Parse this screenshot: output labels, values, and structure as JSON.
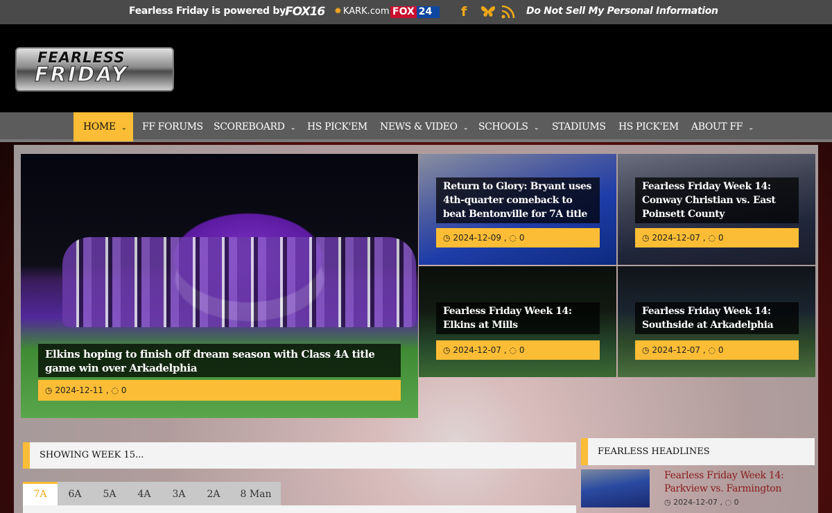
{
  "topbar": {
    "powered_by": "Fearless Friday is powered by:",
    "partners": [
      "FOX16",
      "KARK.com",
      "FOX24"
    ],
    "kark_nbc_glyph": "✹",
    "kark_text": "KARK.com",
    "fox16_text": "FOX16",
    "fox24_a": "FOX",
    "fox24_b": "24",
    "social": {
      "facebook": "f",
      "butterfly": "Ƹ̵̡Ӝ̵̨̄Ʒ",
      "rss": ")))"
    },
    "do_not_sell": "Do Not Sell My Personal Information"
  },
  "header": {
    "logo_line1": "FEARLESS",
    "logo_line2": "FRIDAY"
  },
  "nav": {
    "items": [
      {
        "label": "HOME",
        "dropdown": true,
        "active": true
      },
      {
        "label": "FF FORUMS",
        "dropdown": false
      },
      {
        "label": "SCOREBOARD",
        "dropdown": true
      },
      {
        "label": "HS PICK'EM",
        "dropdown": false
      },
      {
        "label": "NEWS & VIDEO",
        "dropdown": true
      },
      {
        "label": "SCHOOLS",
        "dropdown": true
      },
      {
        "label": "STADIUMS",
        "dropdown": false
      },
      {
        "label": "HS PICK'EM",
        "dropdown": false
      },
      {
        "label": "ABOUT FF",
        "dropdown": true
      }
    ],
    "chevron": "⌄"
  },
  "featured": {
    "main": {
      "title": "Elkins hoping to finish off dream season with Class 4A title game win over Arkadelphia",
      "date": "2024-12-11",
      "comments": "0"
    },
    "tiles": [
      {
        "title": "Return to Glory: Bryant uses 4th-quarter comeback to beat Bentonville for 7A title",
        "date": "2024-12-09",
        "comments": "0"
      },
      {
        "title": "Fearless Friday Week 14: Conway Christian vs. East Poinsett County",
        "date": "2024-12-07",
        "comments": "0"
      },
      {
        "title": "Fearless Friday Week 14: Elkins at Mills",
        "date": "2024-12-07",
        "comments": "0"
      },
      {
        "title": "Fearless Friday Week 14: Southside at Arkadelphia",
        "date": "2024-12-07",
        "comments": "0"
      }
    ],
    "clock_icon": "◷",
    "comment_icon": "◌",
    "meta_sep": ","
  },
  "week_panel": {
    "label": "SHOWING WEEK 15..."
  },
  "classification_tabs": [
    "7A",
    "6A",
    "5A",
    "4A",
    "3A",
    "2A",
    "8 Man"
  ],
  "active_tab": "7A",
  "headlines": {
    "label": "FEARLESS HEADLINES",
    "items": [
      {
        "title": "Fearless Friday Week 14: Parkview vs. Farmington",
        "date": "2024-12-07",
        "comments": "0"
      }
    ]
  },
  "colors": {
    "accent": "#fbbd35",
    "nav_bg": "#5c5c5c",
    "topbar_bg": "#4a4a4a",
    "headline_link": "#8b1a1a"
  }
}
